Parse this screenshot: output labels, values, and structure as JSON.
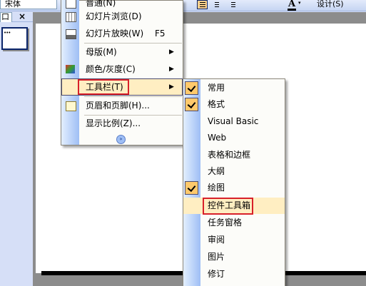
{
  "toolbar": {
    "font_name": "宋体",
    "font_color_letter": "A",
    "font_color_dropdown": "▾",
    "design_label": "设计(S)"
  },
  "pane": {
    "outline_tab": "口",
    "close_glyph": "×",
    "thumb_marks": "•••"
  },
  "menu1": {
    "items": [
      {
        "label": "普通(N)"
      },
      {
        "label": "幻灯片浏览(D)"
      },
      {
        "label": "幻灯片放映(W)",
        "shortcut": "F5"
      },
      {
        "label": "母版(M)",
        "arrow": "▶"
      },
      {
        "label": "颜色/灰度(C)",
        "arrow": "▶"
      },
      {
        "label": "工具栏(T)",
        "arrow": "▶"
      },
      {
        "label": "页眉和页脚(H)..."
      },
      {
        "label": "显示比例(Z)..."
      }
    ],
    "more_glyph": "»"
  },
  "submenu": {
    "items": [
      {
        "label": "常用",
        "checked": true
      },
      {
        "label": "格式",
        "checked": true
      },
      {
        "label": "Visual Basic",
        "checked": false
      },
      {
        "label": "Web",
        "checked": false
      },
      {
        "label": "表格和边框",
        "checked": false
      },
      {
        "label": "大纲",
        "checked": false
      },
      {
        "label": "绘图",
        "checked": true
      },
      {
        "label": "控件工具箱",
        "checked": false
      },
      {
        "label": "任务窗格",
        "checked": false
      },
      {
        "label": "审阅",
        "checked": false
      },
      {
        "label": "图片",
        "checked": false
      },
      {
        "label": "修订",
        "checked": false
      }
    ]
  },
  "colors": {
    "highlight_fill": "#ffeec2",
    "annotation_red": "#d8202a",
    "menu_gutter": "#9ebef5"
  }
}
